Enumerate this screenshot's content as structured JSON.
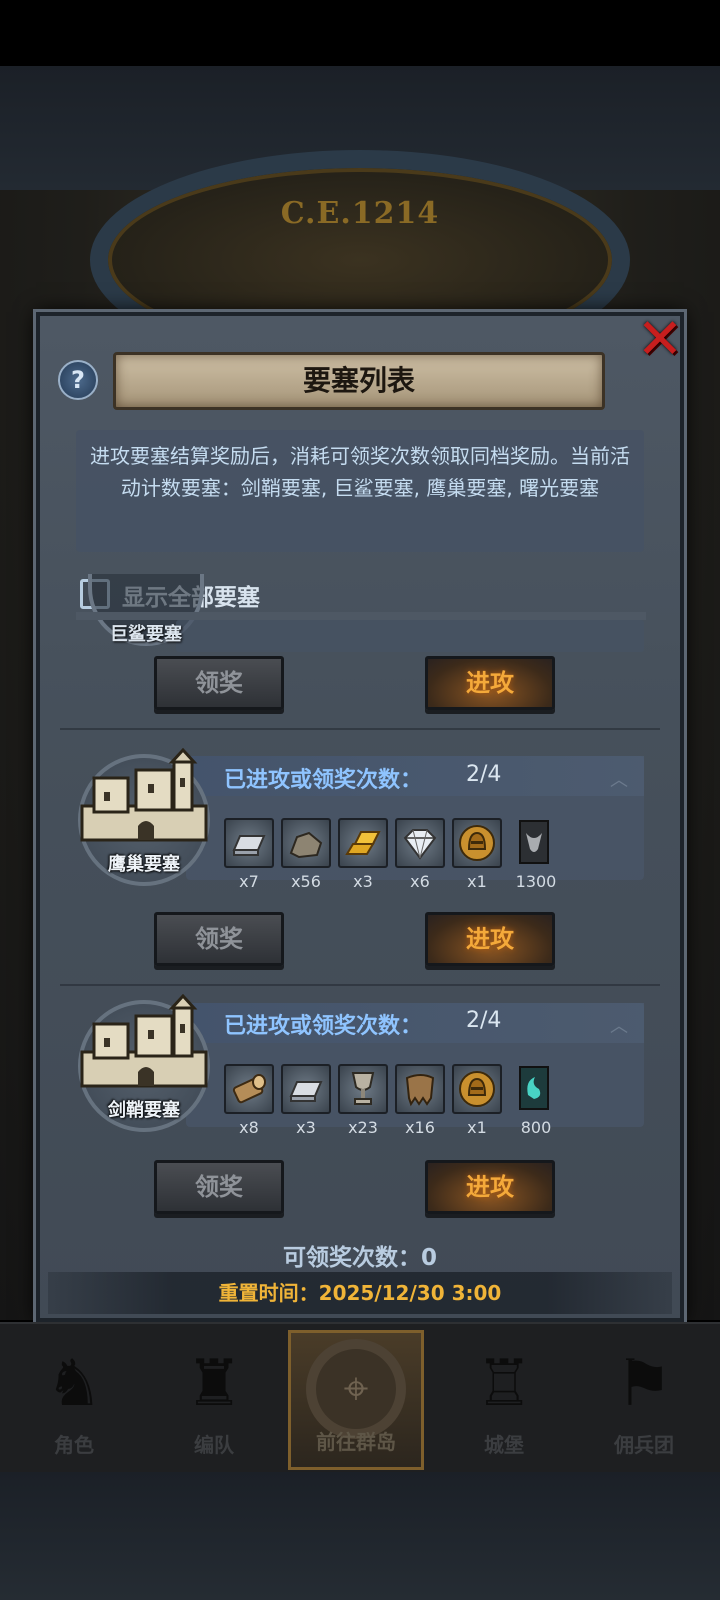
{
  "header": {
    "era": "C.E.1214"
  },
  "dialog": {
    "title": "要塞列表",
    "help_icon": "?",
    "close_icon": "✕",
    "description": "进攻要塞结算奖励后，消耗可领奖次数领取同档奖励。当前活动计数要塞：剑鞘要塞, 巨鲨要塞, 鹰巢要塞, 曙光要塞",
    "show_all_label": "显示全部要塞",
    "partial_fortress": {
      "name": "巨鲨要塞",
      "claim_label": "领奖",
      "attack_label": "进攻"
    },
    "fortresses": [
      {
        "name": "鹰巢要塞",
        "count_label": "已进攻或领奖次数：",
        "count_value": "2/4",
        "claim_label": "领奖",
        "attack_label": "进攻",
        "rewards": [
          {
            "icon": "silver-ingot-icon",
            "qty": "x7"
          },
          {
            "icon": "stone-ore-icon",
            "qty": "x56"
          },
          {
            "icon": "gold-bars-icon",
            "qty": "x3"
          },
          {
            "icon": "diamond-icon",
            "qty": "x6"
          },
          {
            "icon": "knight-helmet-coin-icon",
            "qty": "x1"
          },
          {
            "icon": "banner-bull-icon",
            "qty": "1300"
          }
        ]
      },
      {
        "name": "剑鞘要塞",
        "count_label": "已进攻或领奖次数：",
        "count_value": "2/4",
        "claim_label": "领奖",
        "attack_label": "进攻",
        "rewards": [
          {
            "icon": "wood-log-icon",
            "qty": "x8"
          },
          {
            "icon": "silver-ingot-icon",
            "qty": "x3"
          },
          {
            "icon": "goblet-icon",
            "qty": "x23"
          },
          {
            "icon": "fur-pelt-icon",
            "qty": "x16"
          },
          {
            "icon": "knight-helmet-coin-icon",
            "qty": "x1"
          },
          {
            "icon": "banner-teal-icon",
            "qty": "800"
          }
        ]
      }
    ],
    "claimable_label": "可领奖次数：",
    "claimable_value": "0",
    "reset_label": "重置时间：",
    "reset_time": "2025/12/30 3:00"
  },
  "nav": [
    {
      "label": "角色",
      "icon": "character-icon"
    },
    {
      "label": "编队",
      "icon": "knight-icon"
    },
    {
      "label": "前往群岛",
      "icon": "compass-icon",
      "active": true
    },
    {
      "label": "城堡",
      "icon": "castle-icon"
    },
    {
      "label": "佣兵团",
      "icon": "mercenary-icon"
    }
  ]
}
